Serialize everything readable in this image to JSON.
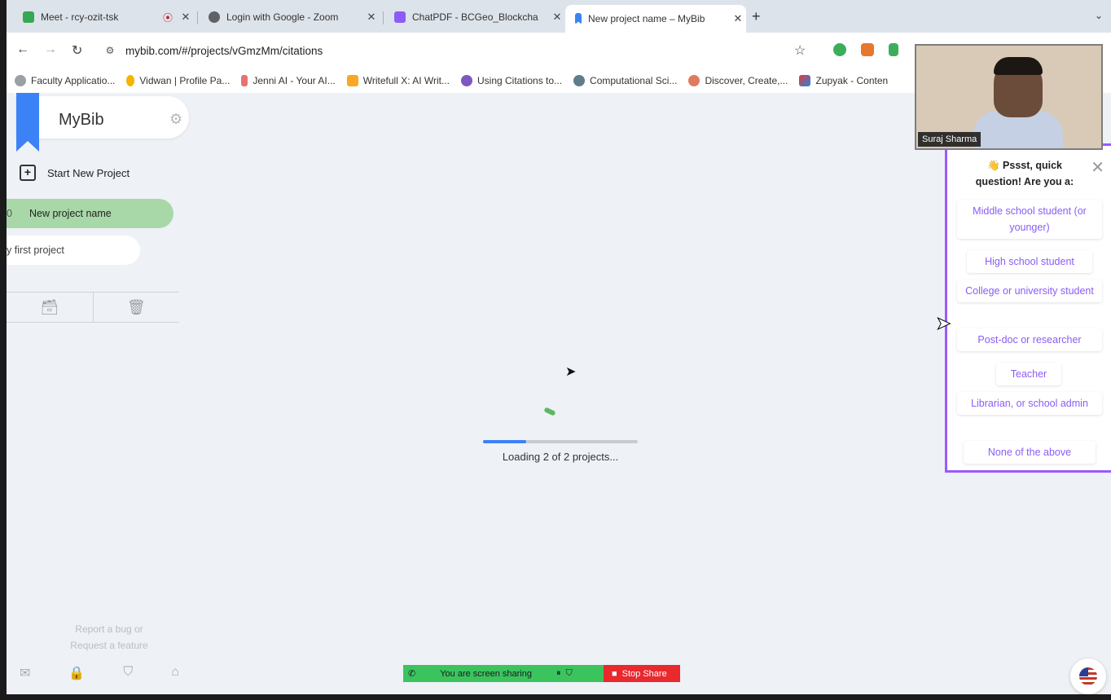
{
  "browser": {
    "tabs": [
      {
        "title": "Meet - rcy-ozit-tsk",
        "favicon_color": "#34a853",
        "recording": true
      },
      {
        "title": "Login with Google - Zoom",
        "favicon_color": "#5f6368"
      },
      {
        "title": "ChatPDF - BCGeo_Blockcha",
        "favicon_color": "#8b5cf6"
      },
      {
        "title": "New project name – MyBib",
        "favicon_color": "#3b82f6",
        "active": true
      }
    ],
    "new_tab_label": "+",
    "close_label": "✕",
    "url": "mybib.com/#/projects/vGmzMm/citations",
    "bookmarks": [
      "Faculty Applicatio...",
      "Vidwan | Profile Pa...",
      "Jenni AI - Your AI...",
      "Writefull X: AI Writ...",
      "Using Citations to...",
      "Computational Sci...",
      "Discover, Create,...",
      "Zupyak - Conten"
    ]
  },
  "sidebar": {
    "brand": "MyBib",
    "new_project_label": "Start New Project",
    "active_project": {
      "number": "0",
      "name": "New project name"
    },
    "other_project": "y first project",
    "report_line1": "Report a bug or",
    "report_line2": "Request a feature"
  },
  "loader": {
    "text": "Loading 2 of 2 projects...",
    "progress": 0.28
  },
  "survey": {
    "question": "👋 Pssst, quick question! Are you a:",
    "options": [
      "Middle school student (or younger)",
      "High school student",
      "College or university student",
      "Post-doc or researcher",
      "Teacher",
      "Librarian, or school admin",
      "None of the above"
    ]
  },
  "video": {
    "participant": "Suraj Sharma"
  },
  "share": {
    "status": "You are screen sharing",
    "stop_label": "Stop Share"
  },
  "colors": {
    "accent": "#3b82f6",
    "active_project": "#a8d8a8",
    "survey_border": "#9b59ff",
    "share_green": "#3bc45e",
    "share_red": "#e8292e"
  }
}
